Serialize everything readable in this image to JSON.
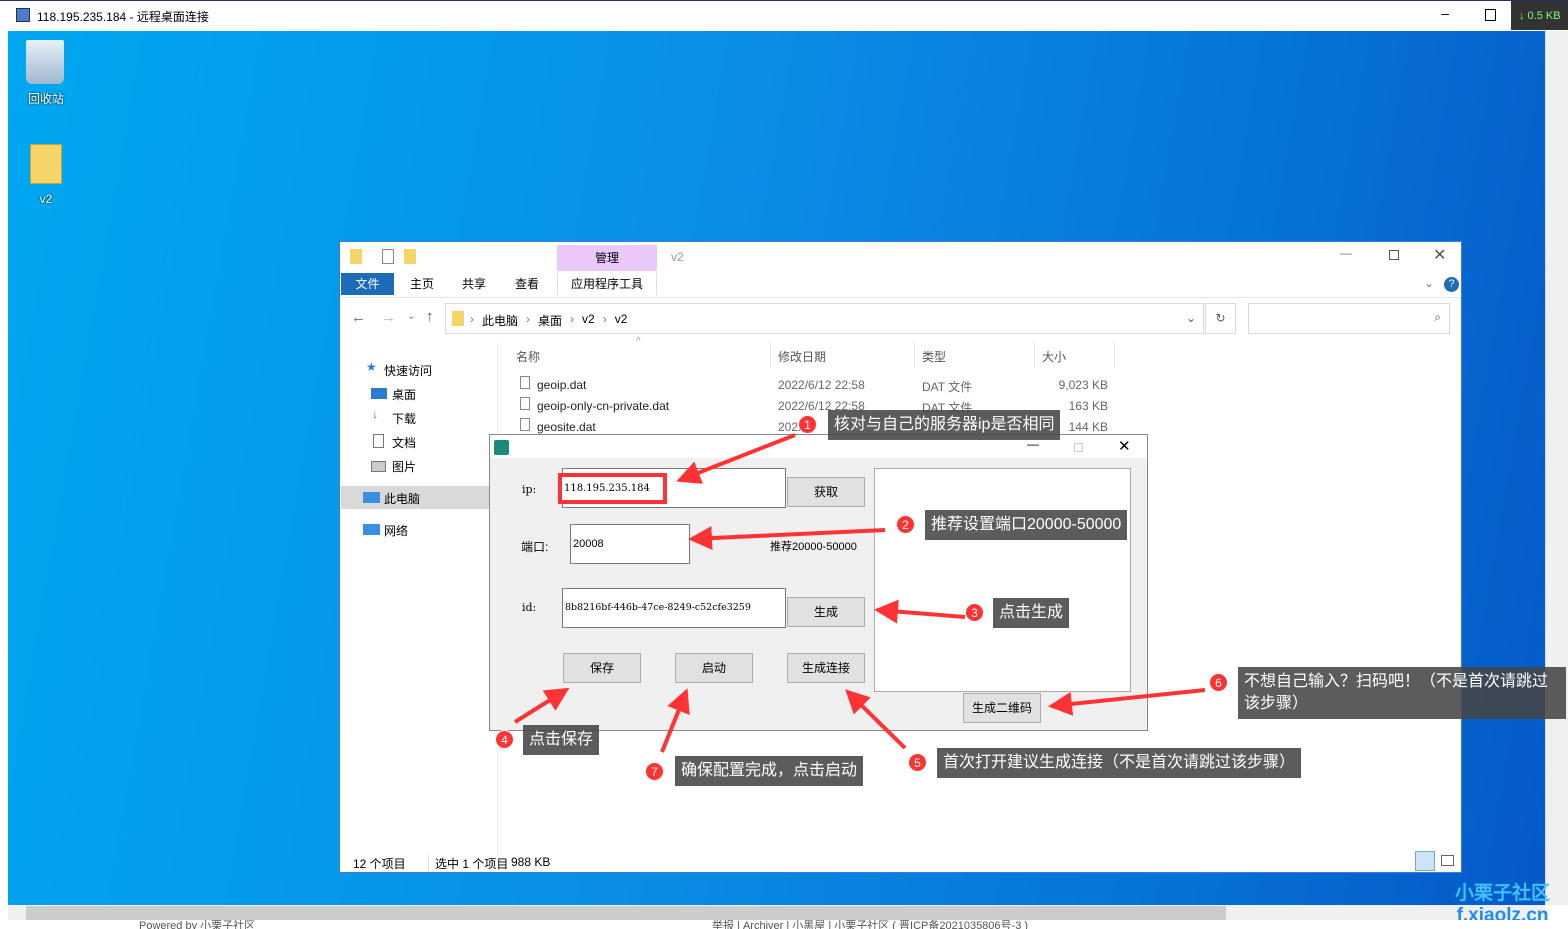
{
  "window": {
    "title": "118.195.235.184 - 远程桌面连接",
    "net_speed": "↓ 0.5 KB"
  },
  "desktop": {
    "icons": [
      {
        "label": "回收站"
      },
      {
        "label": "v2"
      }
    ]
  },
  "explorer": {
    "title": "v2",
    "context_tab": "管理",
    "tabs": [
      "文件",
      "主页",
      "共享",
      "查看",
      "应用程序工具"
    ],
    "breadcrumb": [
      "此电脑",
      "桌面",
      "v2",
      "v2"
    ],
    "nav": [
      "快速访问",
      "桌面",
      "下载",
      "文档",
      "图片",
      "此电脑",
      "网络"
    ],
    "columns": [
      "名称",
      "修改日期",
      "类型",
      "大小"
    ],
    "files": [
      {
        "name": "geoip.dat",
        "date": "2022/6/12 22:58",
        "type": "DAT 文件",
        "size": "9,023 KB"
      },
      {
        "name": "geoip-only-cn-private.dat",
        "date": "2022/6/12 22:58",
        "type": "DAT 文件",
        "size": "163 KB"
      },
      {
        "name": "geosite.dat",
        "date": "2022",
        "type": "",
        "size": "144 KB"
      }
    ],
    "status": {
      "count": "12 个项目",
      "selected": "选中 1 个项目",
      "size": "988 KB"
    }
  },
  "dialog": {
    "ip_label": "ip:",
    "ip_value": "118.195.235.184",
    "fetch": "获取",
    "port_label": "端口:",
    "port_value": "20008",
    "port_hint": "推荐20000-50000",
    "id_label": "id:",
    "id_value": "8b8216bf-446b-47ce-8249-c52cfe3259",
    "generate": "生成",
    "save": "保存",
    "start": "启动",
    "gen_link": "生成连接",
    "gen_qr": "生成二维码"
  },
  "annotations": [
    {
      "n": "1",
      "text": "核对与自己的服务器ip是否相同"
    },
    {
      "n": "2",
      "text": "推荐设置端口20000-50000"
    },
    {
      "n": "3",
      "text": "点击生成"
    },
    {
      "n": "4",
      "text": "点击保存"
    },
    {
      "n": "5",
      "text": "首次打开建议生成连接（不是首次请跳过该步骤）"
    },
    {
      "n": "6",
      "text": "不想自己输入？扫码吧！（不是首次请跳过该步骤）"
    },
    {
      "n": "7",
      "text": "确保配置完成，点击启动"
    }
  ],
  "watermark": {
    "line1": "小栗子社区",
    "line2": "f.xiaolz.cn"
  },
  "footer": {
    "left": "Powered by 小栗子社区",
    "right": "举报 | Archiver | 小黑屋 | 小栗子社区 ( 晋ICP备2021035806号-3 )"
  }
}
